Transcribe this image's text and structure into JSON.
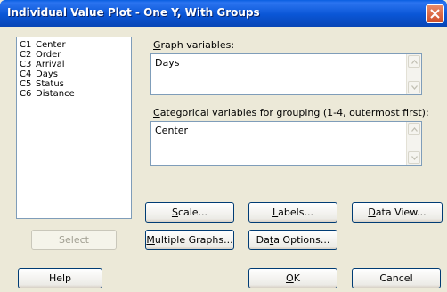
{
  "window": {
    "title": "Individual Value Plot - One Y, With Groups"
  },
  "columns": [
    {
      "id": "C1",
      "name": "Center"
    },
    {
      "id": "C2",
      "name": "Order"
    },
    {
      "id": "C3",
      "name": "Arrival"
    },
    {
      "id": "C4",
      "name": "Days"
    },
    {
      "id": "C5",
      "name": "Status"
    },
    {
      "id": "C6",
      "name": "Distance"
    }
  ],
  "graph_variables": {
    "label_first": "G",
    "label_rest": "raph variables:",
    "value": "Days"
  },
  "categorical": {
    "label_first": "C",
    "label_rest": "ategorical variables for grouping (1-4, outermost first):",
    "value": "Center"
  },
  "buttons": {
    "scale": {
      "u": "S",
      "rest": "cale..."
    },
    "labels": {
      "u": "L",
      "rest": "abels..."
    },
    "data_view": {
      "u": "D",
      "rest": "ata View..."
    },
    "select": "Select",
    "multiple_graphs": {
      "u": "M",
      "rest": "ultiple Graphs..."
    },
    "data_options": {
      "pre": "Da",
      "u": "t",
      "rest": "a Options..."
    },
    "help": "Help",
    "ok": {
      "u": "O",
      "rest": "K"
    },
    "cancel": "Cancel"
  }
}
